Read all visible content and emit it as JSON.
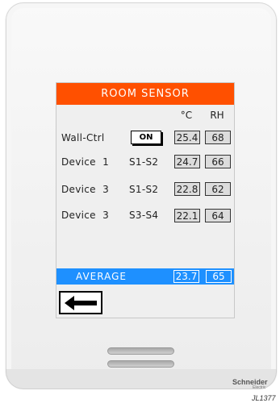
{
  "screen": {
    "title": "ROOM SENSOR",
    "columns": {
      "temp": "°C",
      "rh": "RH"
    },
    "rows": [
      {
        "name": "Wall-Ctrl",
        "button": "ON",
        "temp": "25.4",
        "rh": "68"
      },
      {
        "name": "Device  1",
        "mode": "S1-S2",
        "temp": "24.7",
        "rh": "66"
      },
      {
        "name": "Device  3",
        "mode": "S1-S2",
        "temp": "22.8",
        "rh": "62"
      },
      {
        "name": "Device  3",
        "mode": "S3-S4",
        "temp": "22.1",
        "rh": "64"
      }
    ],
    "average": {
      "label": "AVERAGE",
      "temp": "23.7",
      "rh": "65"
    },
    "back_icon": "left-arrow-icon"
  },
  "device": {
    "brand": "Schneider",
    "brand_sub": "Electric",
    "code": "JL1377"
  },
  "colors": {
    "header": "#ff5000",
    "average_bar": "#1e90ff",
    "screen_bg": "#efefef"
  }
}
